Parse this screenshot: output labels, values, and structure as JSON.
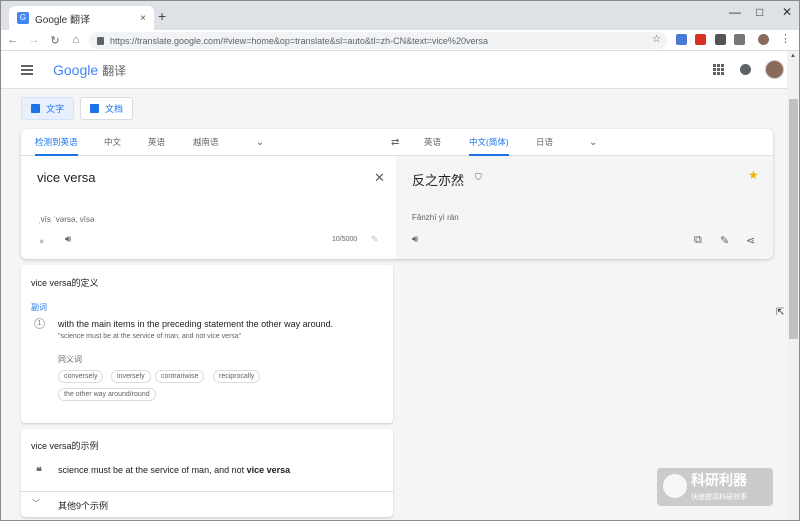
{
  "browser": {
    "tab_title": "Google 翻译",
    "tab_close": "×",
    "new_tab": "+",
    "url": "https://translate.google.com/#view=home&op=translate&sl=auto&tl=zh-CN&text=vice%20versa",
    "window_min": "—",
    "window_max": "□",
    "window_close": "✕"
  },
  "app": {
    "logo_text": "Google",
    "product": "翻译"
  },
  "modes": {
    "text_label": "文字",
    "doc_label": "文档"
  },
  "source_langs": [
    "检测到英语",
    "中文",
    "英语",
    "越南语"
  ],
  "target_langs": [
    "英语",
    "中文(简体)",
    "日语"
  ],
  "source": {
    "text": "vice versa",
    "phonetic": "ˌvīs ˈvərsə, vīsə",
    "char_count": "10/5000"
  },
  "target": {
    "text": "反之亦然",
    "pinyin": "Fǎnzhī yì rán"
  },
  "definitions": {
    "title": "vice versa的定义",
    "pos": "副词",
    "number": "1",
    "definition": "with the main items in the preceding statement the other way around.",
    "example": "\"science must be at the service of man, and not vice versa\"",
    "synonyms_label": "同义词",
    "synonyms": [
      "conversely",
      "inversely",
      "contrariwise",
      "reciprocally",
      "the other way around/round"
    ]
  },
  "examples": {
    "title": "vice versa的示例",
    "sentence_prefix": "science must be at the service of man, and not ",
    "sentence_bold": "vice versa",
    "more_label": "其他9个示例"
  },
  "watermark": {
    "big": "科研利器",
    "small": "快速提高科研效率"
  },
  "colors": {
    "accent": "#1a73e8",
    "star": "#f4b400"
  }
}
